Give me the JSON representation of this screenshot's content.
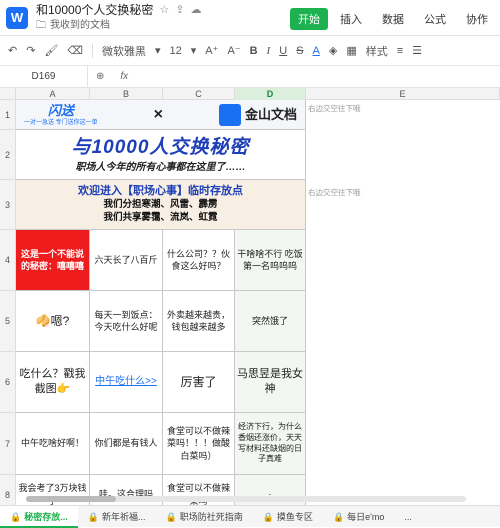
{
  "header": {
    "app_icon": "wps-logo-icon",
    "title": "和10000个人交换秘密",
    "folder": "我收到的文档",
    "menu": [
      "开始",
      "插入",
      "数据",
      "公式",
      "协作"
    ]
  },
  "toolbar": {
    "font": "微软雅黑",
    "size": "12",
    "bold": "B",
    "italic": "I",
    "underline": "U",
    "strike": "S",
    "color_a": "A",
    "style": "样式"
  },
  "formula": {
    "cellref": "D169",
    "fx": "fx"
  },
  "columns": [
    "A",
    "B",
    "C",
    "D",
    "E"
  ],
  "rows": [
    "1",
    "2",
    "3",
    "4",
    "5",
    "6",
    "7",
    "8"
  ],
  "banner": {
    "logo1": "闪送",
    "logo1_sub": "一对一急送 专门送你这一单",
    "times": "×",
    "logo2": "金山文档",
    "headline": "与10000人交换秘密",
    "subline": "职场人今年的所有心事都在这里了……",
    "r3_l1": "欢迎进入【职场心事】临时存放点",
    "r3_l2": "我们分担寒潮、风雷、霹雳",
    "r3_l3": "我们共享雾霭、流岚、虹霓"
  },
  "cells": {
    "r4": [
      "这是一个不能说的秘密：嘻嘻嘻",
      "六天长了八百斤",
      "什么公司？？伙食这么好吗？",
      "干啥啥不行 吃饭第一名呜呜呜"
    ],
    "r5": [
      "🥠嗯?",
      "每天一到饭点：今天吃什么好呢",
      "外卖越来越贵，钱包越来越多",
      "突然饿了"
    ],
    "r6": [
      "吃什么？戳我截图👉",
      "中午吃什么>>",
      "厉害了",
      "马思昱是我女神"
    ],
    "r7": [
      "中午吃啥好啊！",
      "你们都是有钱人",
      "食堂可以不做辣菜吗！！！做酸白菜吗）",
      "经济下行，为什么香烟还涨价，天天写材料还缺烟的日子真难"
    ],
    "r8": [
      "我会考了3万块钱了",
      "哇。这合理吗",
      "食堂可以不做辣菜吗",
      "·"
    ]
  },
  "notes": {
    "n1": "右边交空往下哦",
    "n2": "右边交空往下哦"
  },
  "tabs": [
    "秘密存放...",
    "新年祈福...",
    "职场防社死指南",
    "摸鱼专区",
    "每日e'mo",
    "..."
  ],
  "colors": {
    "accent": "#1eb14f",
    "red_cell": "#ee1c1c",
    "blue_banner": "#1e3fb8"
  }
}
